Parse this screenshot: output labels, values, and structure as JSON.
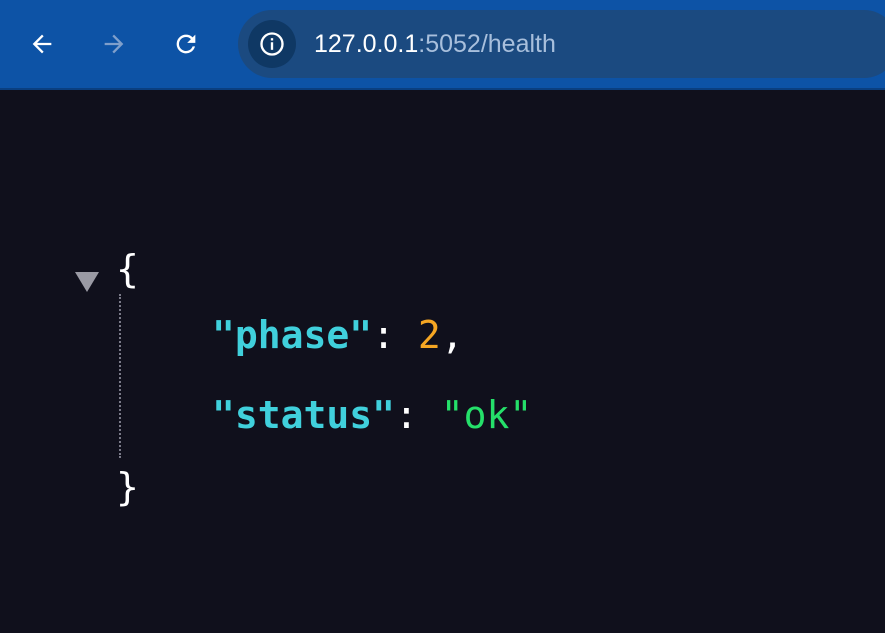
{
  "browser": {
    "url_host": "127.0.0.1",
    "url_rest": ":5052/health",
    "icons": {
      "back": "back-arrow-icon",
      "forward": "forward-arrow-icon",
      "reload": "reload-icon",
      "site_info": "info-icon"
    },
    "colors": {
      "toolbar": "#0d53a6",
      "omnibox": "#1b4a80"
    }
  },
  "json_viewer": {
    "open_brace": "{",
    "close_brace": "}",
    "entries": [
      {
        "key": "\"phase\"",
        "colon": ": ",
        "value": "2",
        "trailing": ",",
        "type": "number"
      },
      {
        "key": "\"status\"",
        "colon": ": ",
        "value": "\"ok\"",
        "trailing": "",
        "type": "string"
      }
    ],
    "colors": {
      "background": "#10101c",
      "key": "#40d0dc",
      "number": "#f5a623",
      "string": "#25e06a"
    }
  }
}
